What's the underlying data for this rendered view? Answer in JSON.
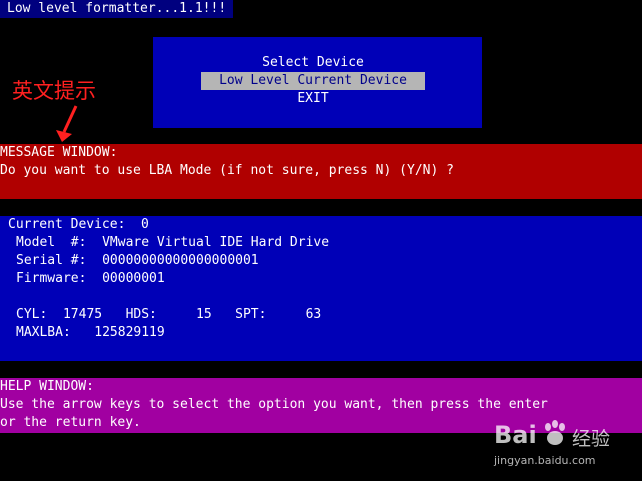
{
  "title": "Low level formatter...1.1!!!",
  "menu": {
    "items": [
      "Select Device",
      "Low Level Current Device",
      "EXIT"
    ],
    "selected_index": 1
  },
  "annotation": {
    "label": "英文提示"
  },
  "message_window": {
    "title": "MESSAGE WINDOW:",
    "text": "Do you want to use LBA Mode (if not sure, press N) (Y/N) ?"
  },
  "device": {
    "current_device": "Current Device:  0",
    "model": "Model  #:  VMware Virtual IDE Hard Drive",
    "serial": "Serial #:  00000000000000000001",
    "firmware": "Firmware:  00000001",
    "geometry": "CYL:  17475   HDS:     15   SPT:     63",
    "maxlba": "MAXLBA:   125829119"
  },
  "help_window": {
    "title": "HELP WINDOW:",
    "line1": "Use the arrow keys to select the option you want, then press the enter",
    "line2": "or the return key."
  },
  "watermark": {
    "logo": "Bai",
    "suffix": "经验",
    "url": "jingyan.baidu.com"
  },
  "colors": {
    "title_bg": "#00007f",
    "menu_bg": "#0000b7",
    "menu_selected_bg": "#b5b5b5",
    "message_bg": "#b00000",
    "help_bg": "#a100a1",
    "annotation": "#ff2020"
  }
}
